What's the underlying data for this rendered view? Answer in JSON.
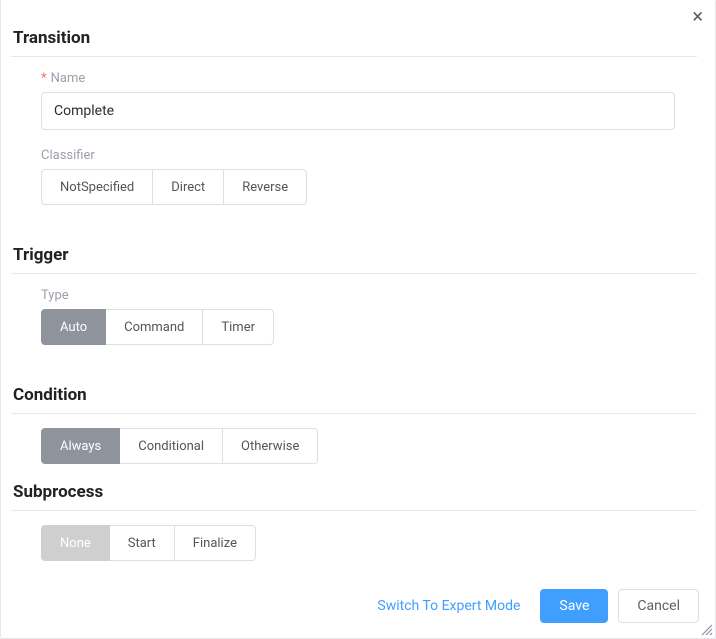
{
  "close_label": "×",
  "sections": {
    "transition": {
      "title": "Transition",
      "name": {
        "label": "Name",
        "required": "*",
        "value": "Complete"
      },
      "classifier": {
        "label": "Classifier",
        "options": [
          "NotSpecified",
          "Direct",
          "Reverse"
        ],
        "selected_index": -1
      }
    },
    "trigger": {
      "title": "Trigger",
      "type": {
        "label": "Type",
        "options": [
          "Auto",
          "Command",
          "Timer"
        ],
        "selected_index": 0
      }
    },
    "condition": {
      "title": "Condition",
      "options": [
        "Always",
        "Conditional",
        "Otherwise"
      ],
      "selected_index": 0
    },
    "subprocess": {
      "title": "Subprocess",
      "options": [
        "None",
        "Start",
        "Finalize"
      ],
      "selected_index": 0,
      "selected_variant": "light"
    }
  },
  "footer": {
    "expert_link": "Switch To Expert Mode",
    "save": "Save",
    "cancel": "Cancel"
  }
}
